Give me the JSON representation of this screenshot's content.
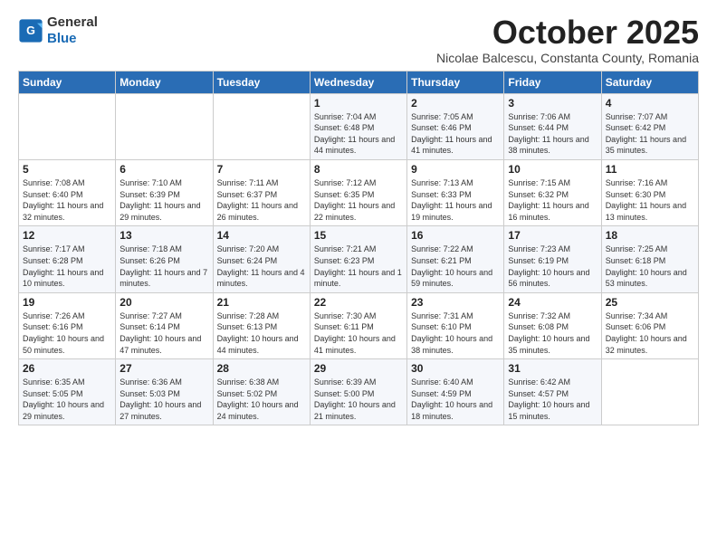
{
  "header": {
    "logo_general": "General",
    "logo_blue": "Blue",
    "month": "October 2025",
    "subtitle": "Nicolae Balcescu, Constanta County, Romania"
  },
  "days_of_week": [
    "Sunday",
    "Monday",
    "Tuesday",
    "Wednesday",
    "Thursday",
    "Friday",
    "Saturday"
  ],
  "weeks": [
    [
      {
        "day": "",
        "info": ""
      },
      {
        "day": "",
        "info": ""
      },
      {
        "day": "",
        "info": ""
      },
      {
        "day": "1",
        "info": "Sunrise: 7:04 AM\nSunset: 6:48 PM\nDaylight: 11 hours and 44 minutes."
      },
      {
        "day": "2",
        "info": "Sunrise: 7:05 AM\nSunset: 6:46 PM\nDaylight: 11 hours and 41 minutes."
      },
      {
        "day": "3",
        "info": "Sunrise: 7:06 AM\nSunset: 6:44 PM\nDaylight: 11 hours and 38 minutes."
      },
      {
        "day": "4",
        "info": "Sunrise: 7:07 AM\nSunset: 6:42 PM\nDaylight: 11 hours and 35 minutes."
      }
    ],
    [
      {
        "day": "5",
        "info": "Sunrise: 7:08 AM\nSunset: 6:40 PM\nDaylight: 11 hours and 32 minutes."
      },
      {
        "day": "6",
        "info": "Sunrise: 7:10 AM\nSunset: 6:39 PM\nDaylight: 11 hours and 29 minutes."
      },
      {
        "day": "7",
        "info": "Sunrise: 7:11 AM\nSunset: 6:37 PM\nDaylight: 11 hours and 26 minutes."
      },
      {
        "day": "8",
        "info": "Sunrise: 7:12 AM\nSunset: 6:35 PM\nDaylight: 11 hours and 22 minutes."
      },
      {
        "day": "9",
        "info": "Sunrise: 7:13 AM\nSunset: 6:33 PM\nDaylight: 11 hours and 19 minutes."
      },
      {
        "day": "10",
        "info": "Sunrise: 7:15 AM\nSunset: 6:32 PM\nDaylight: 11 hours and 16 minutes."
      },
      {
        "day": "11",
        "info": "Sunrise: 7:16 AM\nSunset: 6:30 PM\nDaylight: 11 hours and 13 minutes."
      }
    ],
    [
      {
        "day": "12",
        "info": "Sunrise: 7:17 AM\nSunset: 6:28 PM\nDaylight: 11 hours and 10 minutes."
      },
      {
        "day": "13",
        "info": "Sunrise: 7:18 AM\nSunset: 6:26 PM\nDaylight: 11 hours and 7 minutes."
      },
      {
        "day": "14",
        "info": "Sunrise: 7:20 AM\nSunset: 6:24 PM\nDaylight: 11 hours and 4 minutes."
      },
      {
        "day": "15",
        "info": "Sunrise: 7:21 AM\nSunset: 6:23 PM\nDaylight: 11 hours and 1 minute."
      },
      {
        "day": "16",
        "info": "Sunrise: 7:22 AM\nSunset: 6:21 PM\nDaylight: 10 hours and 59 minutes."
      },
      {
        "day": "17",
        "info": "Sunrise: 7:23 AM\nSunset: 6:19 PM\nDaylight: 10 hours and 56 minutes."
      },
      {
        "day": "18",
        "info": "Sunrise: 7:25 AM\nSunset: 6:18 PM\nDaylight: 10 hours and 53 minutes."
      }
    ],
    [
      {
        "day": "19",
        "info": "Sunrise: 7:26 AM\nSunset: 6:16 PM\nDaylight: 10 hours and 50 minutes."
      },
      {
        "day": "20",
        "info": "Sunrise: 7:27 AM\nSunset: 6:14 PM\nDaylight: 10 hours and 47 minutes."
      },
      {
        "day": "21",
        "info": "Sunrise: 7:28 AM\nSunset: 6:13 PM\nDaylight: 10 hours and 44 minutes."
      },
      {
        "day": "22",
        "info": "Sunrise: 7:30 AM\nSunset: 6:11 PM\nDaylight: 10 hours and 41 minutes."
      },
      {
        "day": "23",
        "info": "Sunrise: 7:31 AM\nSunset: 6:10 PM\nDaylight: 10 hours and 38 minutes."
      },
      {
        "day": "24",
        "info": "Sunrise: 7:32 AM\nSunset: 6:08 PM\nDaylight: 10 hours and 35 minutes."
      },
      {
        "day": "25",
        "info": "Sunrise: 7:34 AM\nSunset: 6:06 PM\nDaylight: 10 hours and 32 minutes."
      }
    ],
    [
      {
        "day": "26",
        "info": "Sunrise: 6:35 AM\nSunset: 5:05 PM\nDaylight: 10 hours and 29 minutes."
      },
      {
        "day": "27",
        "info": "Sunrise: 6:36 AM\nSunset: 5:03 PM\nDaylight: 10 hours and 27 minutes."
      },
      {
        "day": "28",
        "info": "Sunrise: 6:38 AM\nSunset: 5:02 PM\nDaylight: 10 hours and 24 minutes."
      },
      {
        "day": "29",
        "info": "Sunrise: 6:39 AM\nSunset: 5:00 PM\nDaylight: 10 hours and 21 minutes."
      },
      {
        "day": "30",
        "info": "Sunrise: 6:40 AM\nSunset: 4:59 PM\nDaylight: 10 hours and 18 minutes."
      },
      {
        "day": "31",
        "info": "Sunrise: 6:42 AM\nSunset: 4:57 PM\nDaylight: 10 hours and 15 minutes."
      },
      {
        "day": "",
        "info": ""
      }
    ]
  ]
}
